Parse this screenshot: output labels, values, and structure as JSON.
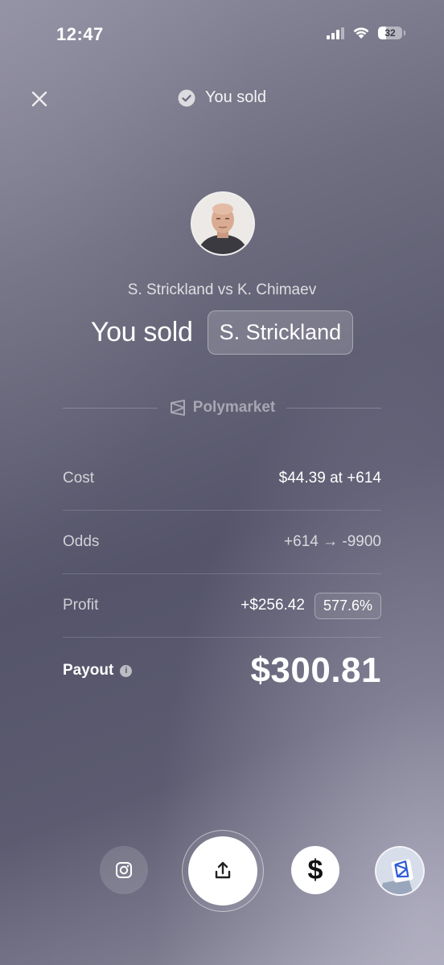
{
  "status_bar": {
    "time": "12:47",
    "battery": "32"
  },
  "header": {
    "title": "You sold"
  },
  "bet": {
    "matchup": "S. Strickland vs K. Chimaev",
    "sold_label": "You sold",
    "selection": "S. Strickland"
  },
  "brand": {
    "name": "Polymarket"
  },
  "details": {
    "cost_label": "Cost",
    "cost_value": "$44.39 at +614",
    "odds_label": "Odds",
    "odds_value": "+614 → -9900",
    "profit_label": "Profit",
    "profit_value": "+$256.42",
    "profit_pct": "577.6%",
    "payout_label": "Payout",
    "payout_value": "$300.81"
  },
  "actions": [
    {
      "icon": "instagram-icon"
    },
    {
      "icon": "share-icon"
    },
    {
      "icon": "cash-app-icon"
    },
    {
      "icon": "polymarket-icon"
    }
  ],
  "colors": {
    "background_top": "#8f8ea0",
    "background_mid": "#55546a",
    "accent_white": "#ffffff"
  }
}
